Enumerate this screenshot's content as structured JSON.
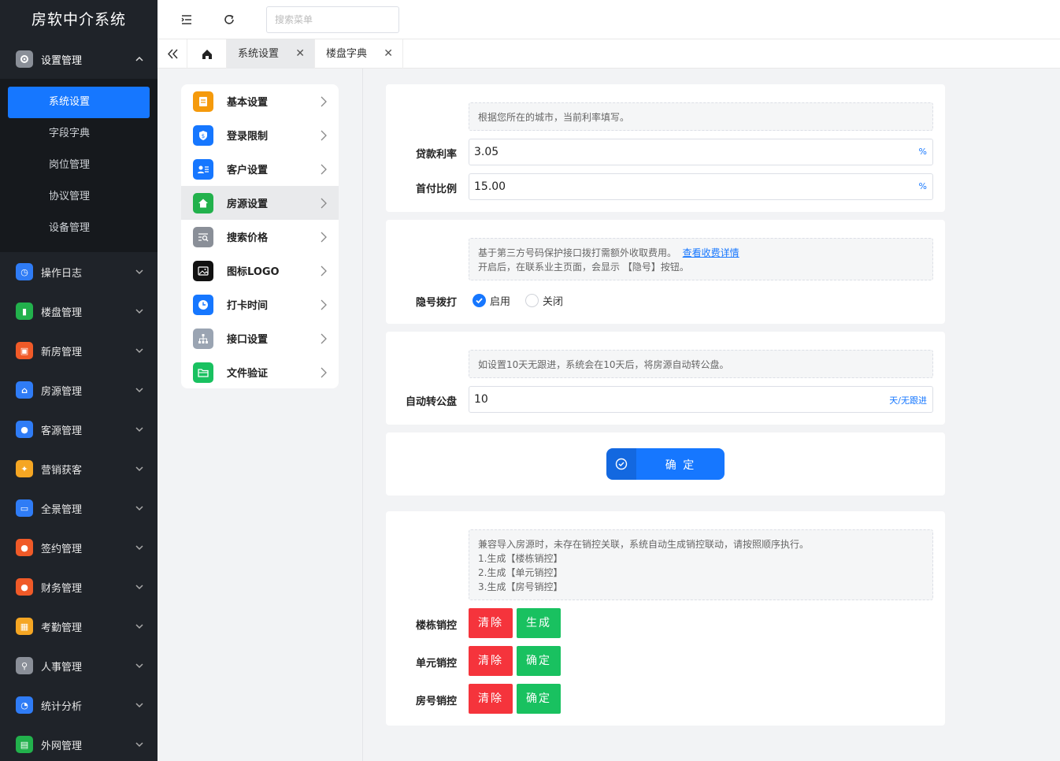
{
  "app": {
    "title": "房软中介系统"
  },
  "sidebar": {
    "open_group": {
      "label": "设置管理",
      "color": "#8a8f98"
    },
    "submenu": [
      "系统设置",
      "字段字典",
      "岗位管理",
      "协议管理",
      "设备管理"
    ],
    "groups": [
      {
        "label": "操作日志",
        "color": "#2f7cf6"
      },
      {
        "label": "楼盘管理",
        "color": "#22b14c"
      },
      {
        "label": "新房管理",
        "color": "#f05a28"
      },
      {
        "label": "房源管理",
        "color": "#2f7cf6"
      },
      {
        "label": "客源管理",
        "color": "#2f7cf6"
      },
      {
        "label": "营销获客",
        "color": "#f5a623"
      },
      {
        "label": "全景管理",
        "color": "#2f7cf6"
      },
      {
        "label": "签约管理",
        "color": "#f05a28"
      },
      {
        "label": "财务管理",
        "color": "#f05a28"
      },
      {
        "label": "考勤管理",
        "color": "#f5a623"
      },
      {
        "label": "人事管理",
        "color": "#8a8f98"
      },
      {
        "label": "统计分析",
        "color": "#2f7cf6"
      },
      {
        "label": "外网管理",
        "color": "#22b14c"
      }
    ]
  },
  "topbar": {
    "search_placeholder": "搜索菜单"
  },
  "tabs": {
    "t1": "系统设置",
    "t2": "楼盘字典"
  },
  "settings_menu": [
    {
      "label": "基本设置",
      "color": "#f59a0c"
    },
    {
      "label": "登录限制",
      "color": "#1677ff"
    },
    {
      "label": "客户设置",
      "color": "#1677ff"
    },
    {
      "label": "房源设置",
      "color": "#22b14c"
    },
    {
      "label": "搜索价格",
      "color": "#8a8f98"
    },
    {
      "label": "图标LOGO",
      "color": "#111111"
    },
    {
      "label": "打卡时间",
      "color": "#1677ff"
    },
    {
      "label": "接口设置",
      "color": "#9aa4b2"
    },
    {
      "label": "文件验证",
      "color": "#19c160"
    }
  ],
  "loan": {
    "note": "根据您所在的城市，当前利率填写。",
    "rate_label": "贷款利率",
    "rate_value": "3.05",
    "rate_unit": "%",
    "down_label": "首付比例",
    "down_value": "15.00",
    "down_unit": "%"
  },
  "hidden_call": {
    "note_line1": "基于第三方号码保护接口拨打需额外收取费用。",
    "note_link": "查看收费详情",
    "note_line2": "开启后，在联系业主页面，会显示 【隐号】按钮。",
    "label": "隐号拨打",
    "on": "启用",
    "off": "关闭"
  },
  "auto_public": {
    "note": "如设置10天无跟进，系统会在10天后，将房源自动转公盘。",
    "label": "自动转公盘",
    "value": "10",
    "unit": "天/无跟进"
  },
  "confirm_label": "确 定",
  "sales_control": {
    "note_line1": "兼容导入房源时，未存在销控关联，系统自动生成销控联动，请按照顺序执行。",
    "note_line2": "1.生成【楼栋销控】",
    "note_line3": "2.生成【单元销控】",
    "note_line4": "3.生成【房号销控】",
    "building_label": "楼栋销控",
    "unit_label": "单元销控",
    "room_label": "房号销控",
    "clear": "清除",
    "generate": "生成",
    "confirm": "确定"
  }
}
